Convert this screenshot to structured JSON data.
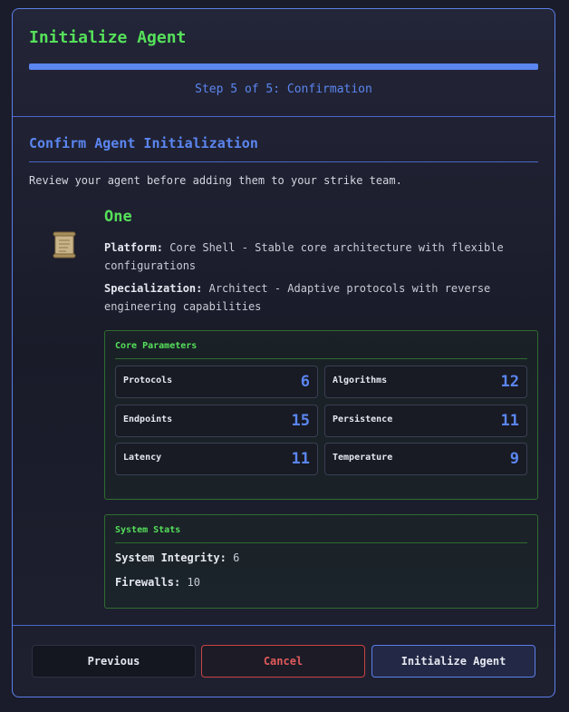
{
  "header": {
    "title": "Initialize Agent",
    "progress_fraction": 1.0,
    "step_label": "Step 5 of 5: Confirmation"
  },
  "confirm": {
    "section_title": "Confirm Agent Initialization",
    "intro": "Review your agent before adding them to your strike team.",
    "agent": {
      "icon": "scroll-icon",
      "name": "One",
      "platform_label": "Platform:",
      "platform_value": "Core Shell - Stable core architecture with flexible configurations",
      "specialization_label": "Specialization:",
      "specialization_value": "Architect - Adaptive protocols with reverse engineering capabilities"
    },
    "core_parameters": {
      "title": "Core Parameters",
      "items": [
        {
          "label": "Protocols",
          "value": "6"
        },
        {
          "label": "Algorithms",
          "value": "12"
        },
        {
          "label": "Endpoints",
          "value": "15"
        },
        {
          "label": "Persistence",
          "value": "11"
        },
        {
          "label": "Latency",
          "value": "11"
        },
        {
          "label": "Temperature",
          "value": "9"
        }
      ]
    },
    "system_stats": {
      "title": "System Stats",
      "integrity_label": "System Integrity:",
      "integrity_value": "6",
      "firewalls_label": "Firewalls:",
      "firewalls_value": "10"
    }
  },
  "footer": {
    "previous_label": "Previous",
    "cancel_label": "Cancel",
    "initialize_label": "Initialize Agent"
  },
  "colors": {
    "accent_blue": "#5b86f0",
    "accent_green": "#55e05a",
    "danger_red": "#e05a5a"
  }
}
